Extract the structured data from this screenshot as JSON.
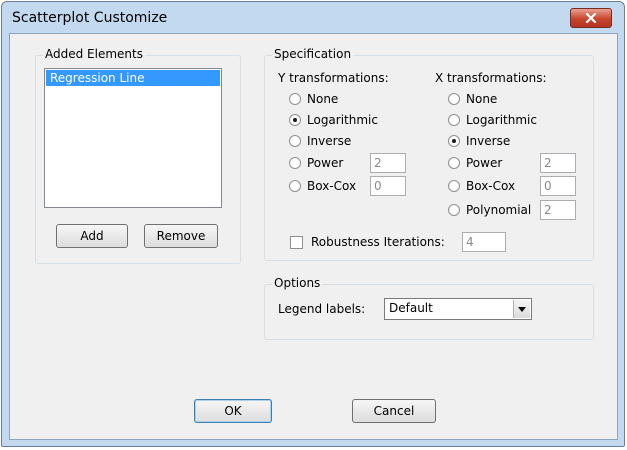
{
  "window": {
    "title": "Scatterplot Customize"
  },
  "added_elements": {
    "legend": "Added Elements",
    "items": [
      "Regression Line"
    ],
    "add_label": "Add",
    "remove_label": "Remove"
  },
  "specification": {
    "legend": "Specification",
    "y": {
      "heading": "Y transformations:",
      "options": [
        "None",
        "Logarithmic",
        "Inverse",
        "Power",
        "Box-Cox"
      ],
      "selected": "Logarithmic",
      "power_value": "2",
      "boxcox_value": "0"
    },
    "x": {
      "heading": "X transformations:",
      "options": [
        "None",
        "Logarithmic",
        "Inverse",
        "Power",
        "Box-Cox",
        "Polynomial"
      ],
      "selected": "Inverse",
      "power_value": "2",
      "boxcox_value": "0",
      "polynomial_value": "2"
    },
    "robustness": {
      "label": "Robustness Iterations:",
      "value": "4",
      "checked": false
    }
  },
  "options": {
    "legend": "Options",
    "legend_labels_label": "Legend labels:",
    "legend_labels_value": "Default"
  },
  "footer": {
    "ok_label": "OK",
    "cancel_label": "Cancel"
  }
}
